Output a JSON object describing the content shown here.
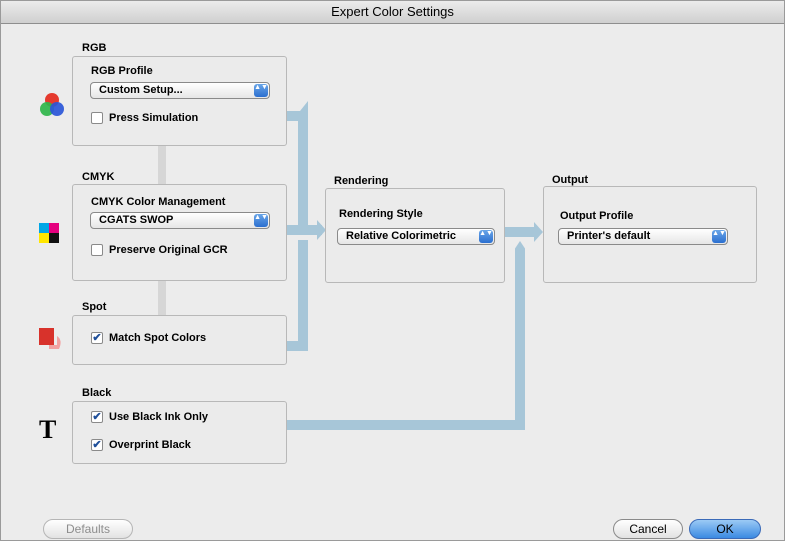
{
  "window": {
    "title": "Expert Color Settings"
  },
  "rgb": {
    "section": "RGB",
    "profile_label": "RGB Profile",
    "profile_value": "Custom Setup...",
    "press_sim_label": "Press Simulation",
    "press_sim_checked": false,
    "icon": "rgb-circles-icon"
  },
  "cmyk": {
    "section": "CMYK",
    "mgmt_label": "CMYK Color Management",
    "mgmt_value": "CGATS SWOP",
    "preserve_label": "Preserve Original GCR",
    "preserve_checked": false,
    "icon": "cmyk-squares-icon"
  },
  "spot": {
    "section": "Spot",
    "match_label": "Match Spot Colors",
    "match_checked": true,
    "icon": "spot-swatch-icon"
  },
  "black": {
    "section": "Black",
    "use_black_label": "Use Black Ink Only",
    "use_black_checked": true,
    "overprint_label": "Overprint Black",
    "overprint_checked": true,
    "icon": "text-t-icon",
    "icon_glyph": "T"
  },
  "rendering": {
    "section": "Rendering",
    "style_label": "Rendering Style",
    "style_value": "Relative Colorimetric"
  },
  "output": {
    "section": "Output",
    "profile_label": "Output Profile",
    "profile_value": "Printer's default"
  },
  "buttons": {
    "defaults": "Defaults",
    "cancel": "Cancel",
    "ok": "OK"
  },
  "glyphs": {
    "checkmark": "✔",
    "updown": "▲▼"
  },
  "colors": {
    "pipe": "#a7c6d8",
    "primary_button": "#3b8ae2"
  }
}
